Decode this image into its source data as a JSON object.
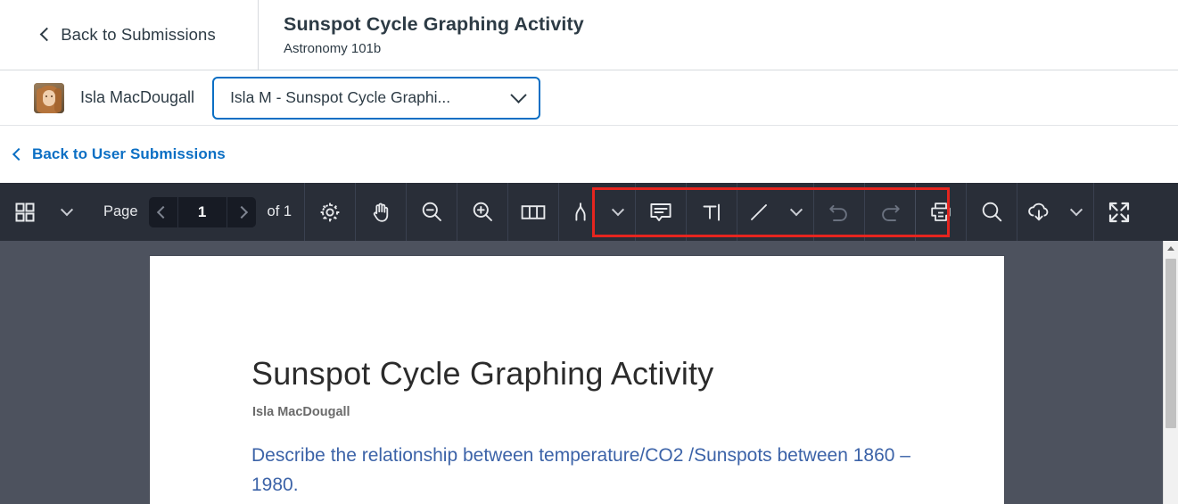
{
  "header": {
    "back_label": "Back to Submissions",
    "back_icon": "chevron-left-icon",
    "title": "Sunspot Cycle Graphing Activity",
    "course": "Astronomy 101b"
  },
  "userbar": {
    "avatar_alt": "Isla MacDougall avatar",
    "user_name": "Isla MacDougall",
    "submission_select": {
      "value": "Isla M - Sunspot Cycle Graphi...",
      "chevron_icon": "chevron-down-icon"
    }
  },
  "backrow": {
    "label": "Back to User Submissions",
    "icon": "chevron-left-icon"
  },
  "toolbar": {
    "thumbnails_icon": "grid-thumbnails-icon",
    "thumbnails_caret_icon": "chevron-down-icon",
    "page_label": "Page",
    "page_prev_icon": "chevron-left-icon",
    "page_value": "1",
    "page_next_icon": "chevron-right-icon",
    "page_of": "of 1",
    "settings_icon": "gear-icon",
    "pan_icon": "hand-icon",
    "zoom_out_icon": "magnifier-minus-icon",
    "zoom_in_icon": "magnifier-plus-icon",
    "page_layout_icon": "page-layout-icon",
    "ink_icon": "ink-pen-icon",
    "ink_caret_icon": "chevron-down-icon",
    "comment_icon": "comment-bubble-icon",
    "text_icon": "text-tool-icon",
    "line_icon": "line-tool-icon",
    "line_caret_icon": "chevron-down-icon",
    "undo_icon": "undo-icon",
    "redo_icon": "redo-icon",
    "print_icon": "printer-icon",
    "search_icon": "search-icon",
    "download_icon": "cloud-download-icon",
    "download_caret_icon": "chevron-down-icon",
    "fullscreen_icon": "fullscreen-icon"
  },
  "highlight": {
    "color": "#e5251f"
  },
  "document": {
    "title": "Sunspot Cycle Graphing Activity",
    "author": "Isla MacDougall",
    "prompt": "Describe the relationship between temperature/CO2 /Sunspots between 1860 – 1980."
  },
  "scrollbar": {
    "up_icon": "scroll-up-arrow-icon",
    "thumb": "scroll-thumb"
  },
  "colors": {
    "toolbar_bg": "#292e38",
    "viewer_bg": "#4d525e",
    "accent_blue": "#0b6fc4",
    "highlight_red": "#e5251f",
    "prompt_blue": "#3c63a8"
  }
}
